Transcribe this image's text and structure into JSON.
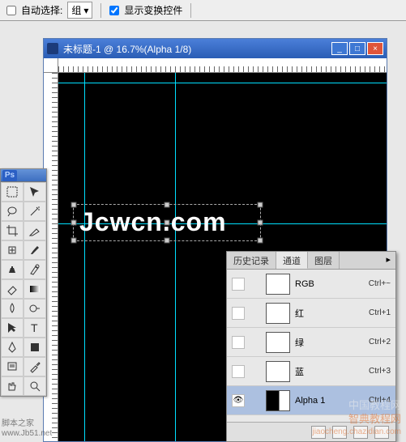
{
  "toolbar": {
    "auto_select_label": "自动选择:",
    "group_label": "组",
    "show_transform_label": "显示变换控件"
  },
  "doc": {
    "title": "未标题-1 @ 16.7%(Alpha 1/8)",
    "canvas_text": "Jcwcn.com"
  },
  "panel": {
    "tabs": {
      "history": "历史记录",
      "channels": "通道",
      "layers": "图层"
    },
    "channels": [
      {
        "name": "RGB",
        "shortcut": "Ctrl+~",
        "selected": false,
        "eye": false,
        "thumb": "white"
      },
      {
        "name": "红",
        "shortcut": "Ctrl+1",
        "selected": false,
        "eye": false,
        "thumb": "white"
      },
      {
        "name": "绿",
        "shortcut": "Ctrl+2",
        "selected": false,
        "eye": false,
        "thumb": "white"
      },
      {
        "name": "蓝",
        "shortcut": "Ctrl+3",
        "selected": false,
        "eye": false,
        "thumb": "white"
      },
      {
        "name": "Alpha 1",
        "shortcut": "Ctrl+4",
        "selected": true,
        "eye": true,
        "thumb": "alpha"
      }
    ]
  },
  "watermark": {
    "left_line1": "脚本之家",
    "left_line2": "www.Jb51.net",
    "right_line1": "中国教程网",
    "right_line2": "智典教程网",
    "right_line3": "jiaocheng.chazidian.com"
  }
}
